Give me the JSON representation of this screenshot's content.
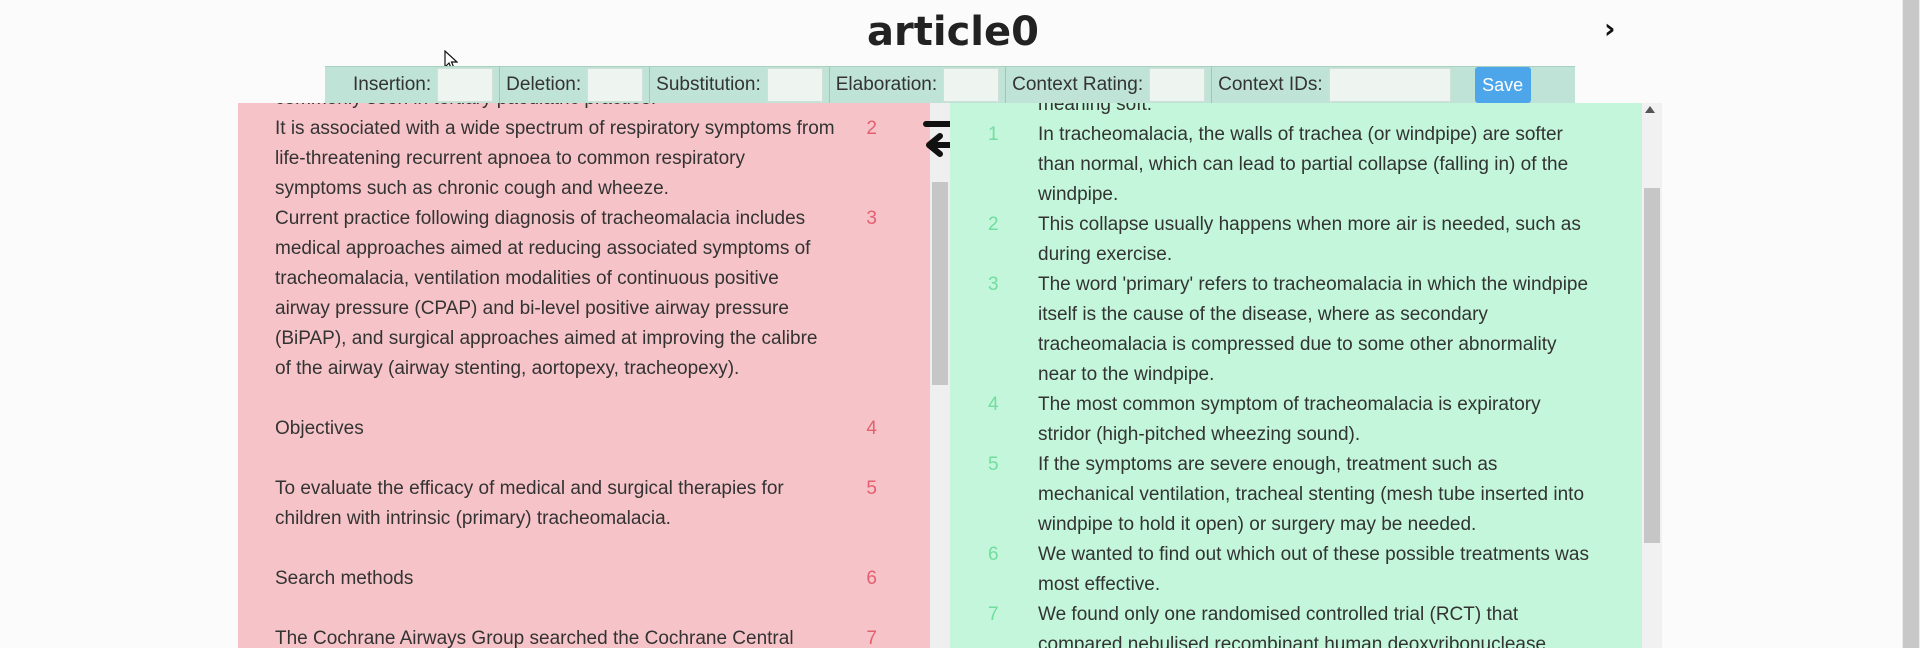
{
  "title": "article0",
  "nav": {
    "next_glyph": "›"
  },
  "toolbar": {
    "insertion_label": "Insertion:",
    "deletion_label": "Deletion:",
    "substitution_label": "Substitution:",
    "elaboration_label": "Elaboration:",
    "context_rating_label": "Context Rating:",
    "context_ids_label": "Context IDs:",
    "save_label": "Save"
  },
  "left": {
    "rows": [
      {
        "text": "commonly seen in tertiary paediatric practice.",
        "num": ""
      },
      {
        "text": "It is associated with a wide spectrum of respiratory symptoms from life-threatening recurrent apnoea to common respiratory symptoms such as chronic cough and wheeze.",
        "num": "2"
      },
      {
        "text": "Current practice following diagnosis of tracheomalacia includes medical approaches aimed at reducing associated symptoms of tracheomalacia, ventilation modalities of continuous positive airway pressure (CPAP) and bi-level positive airway pressure (BiPAP), and surgical approaches aimed at improving the calibre of the airway (airway stenting, aortopexy, tracheopexy).",
        "num": "3"
      },
      {
        "text": "Objectives",
        "num": "4"
      },
      {
        "text": "To evaluate the efficacy of medical and surgical therapies for children with intrinsic (primary) tracheomalacia.",
        "num": "5"
      },
      {
        "text": "Search methods",
        "num": "6"
      },
      {
        "text": "The Cochrane Airways Group searched the Cochrane Central",
        "num": "7"
      }
    ]
  },
  "right": {
    "rows": [
      {
        "text": "meaning soft.",
        "num": ""
      },
      {
        "text": "In tracheomalacia, the walls of trachea (or windpipe) are softer than normal, which can lead to partial collapse (falling in) of the windpipe.",
        "num": "1"
      },
      {
        "text": "This collapse usually happens when more air is needed, such as during exercise.",
        "num": "2"
      },
      {
        "text": "The word 'primary' refers to tracheomalacia in which the windpipe itself is the cause of the disease, where as secondary tracheomalacia is compressed due to some other abnormality near to the windpipe.",
        "num": "3"
      },
      {
        "text": "The most common symptom of tracheomalacia is expiratory stridor (high-pitched wheezing sound).",
        "num": "4"
      },
      {
        "text": "If the symptoms are severe enough, treatment such as mechanical ventilation, tracheal stenting (mesh tube inserted into windpipe to hold it open) or surgery may be needed.",
        "num": "5"
      },
      {
        "text": "We wanted to find out which out of these possible treatments was most effective.",
        "num": "6"
      },
      {
        "text": "We found only one randomised controlled trial (RCT) that compared nebulised recombinant human deoxyribonuclease",
        "num": "7"
      }
    ]
  },
  "colors": {
    "left_bg": "#f6c4c8",
    "right_bg": "#c3f6da",
    "toolbar_bg": "#bfe3d6",
    "save_bg": "#4ea6ea",
    "left_num": "#e2606f",
    "right_num": "#72dd9f"
  },
  "icons": {
    "swap": "swap-arrows-icon",
    "next": "chevron-right-icon",
    "cursor": "mouse-pointer-icon"
  }
}
